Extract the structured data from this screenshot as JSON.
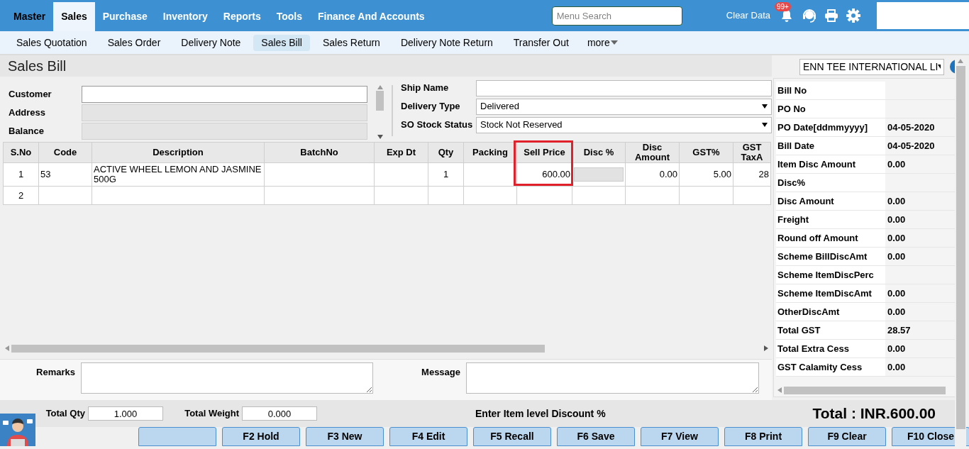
{
  "menu": [
    {
      "label": "Master",
      "selected": false
    },
    {
      "label": "Sales",
      "selected": true
    },
    {
      "label": "Purchase",
      "selected": false
    },
    {
      "label": "Inventory",
      "selected": false
    },
    {
      "label": "Reports",
      "selected": false
    },
    {
      "label": "Tools",
      "selected": false
    },
    {
      "label": "Finance And Accounts",
      "selected": false
    }
  ],
  "menu_search": {
    "placeholder": "Menu Search"
  },
  "clear_data": "Clear Data",
  "notification_badge": "99+",
  "submenu": [
    {
      "label": "Sales Quotation",
      "selected": false
    },
    {
      "label": "Sales Order",
      "selected": false
    },
    {
      "label": "Delivery Note",
      "selected": false
    },
    {
      "label": "Sales Bill",
      "selected": true
    },
    {
      "label": "Sales Return",
      "selected": false
    },
    {
      "label": "Delivery Note Return",
      "selected": false
    },
    {
      "label": "Transfer Out",
      "selected": false
    }
  ],
  "more": "more",
  "page_title": "Sales Bill",
  "company": "ENN TEE INTERNATIONAL LI",
  "left_fields": [
    {
      "label": "Customer",
      "disabled": false
    },
    {
      "label": "Address",
      "disabled": true
    },
    {
      "label": "Balance",
      "disabled": true
    }
  ],
  "right_fields": [
    {
      "label": "Ship Name",
      "kind": "text"
    },
    {
      "label": "Delivery Type",
      "kind": "select",
      "value": "Delivered"
    },
    {
      "label": "SO Stock Status",
      "kind": "select",
      "value": "Stock Not Reserved"
    }
  ],
  "table": {
    "columns": [
      {
        "label": "S.No",
        "highlight": false
      },
      {
        "label": "Code",
        "highlight": false
      },
      {
        "label": "Description",
        "highlight": false
      },
      {
        "label": "BatchNo",
        "highlight": false
      },
      {
        "label": "Exp Dt",
        "highlight": false
      },
      {
        "label": "Qty",
        "highlight": false
      },
      {
        "label": "Packing",
        "highlight": false
      },
      {
        "label": "Sell Price",
        "highlight": true
      },
      {
        "label": "Disc %",
        "highlight": false
      },
      {
        "label": "Disc Amount",
        "highlight": false
      },
      {
        "label": "GST%",
        "highlight": false
      },
      {
        "label": "GST TaxA",
        "highlight": false
      }
    ],
    "rows": [
      [
        "1",
        "53",
        "ACTIVE WHEEL LEMON AND JASMINE 500G",
        "",
        "",
        "1",
        "",
        "600.00",
        "",
        "0.00",
        "5.00",
        "28"
      ],
      [
        "2",
        "",
        "",
        "",
        "",
        "",
        "",
        "",
        "",
        "",
        "",
        ""
      ]
    ]
  },
  "summary": [
    {
      "label": "Bill No"
    },
    {
      "label": "PO No"
    },
    {
      "label": "PO Date[ddmmyyyy]",
      "value": "04-05-2020"
    },
    {
      "label": "Bill Date",
      "value": "04-05-2020"
    },
    {
      "label": "Item Disc Amount",
      "value": "0.00"
    },
    {
      "label": "Disc%"
    },
    {
      "label": "Disc Amount",
      "value": "0.00"
    },
    {
      "label": "Freight",
      "value": "0.00"
    },
    {
      "label": "Round off Amount",
      "value": "0.00"
    },
    {
      "label": "Scheme BillDiscAmt",
      "value": "0.00"
    },
    {
      "label": "Scheme ItemDiscPerc"
    },
    {
      "label": "Scheme ItemDiscAmt",
      "value": "0.00"
    },
    {
      "label": "OtherDiscAmt",
      "value": "0.00"
    },
    {
      "label": "Total GST",
      "value": "28.57"
    },
    {
      "label": "Total Extra Cess",
      "value": "0.00"
    },
    {
      "label": "GST Calamity Cess",
      "value": "0.00"
    }
  ],
  "remarks_label": "Remarks",
  "message_label": "Message",
  "total_qty": {
    "label": "Total Qty",
    "value": "1.000"
  },
  "total_weight": {
    "label": "Total Weight",
    "value": "0.000"
  },
  "hint": "Enter Item level Discount %",
  "total": "Total : INR.600.00",
  "buttons": [
    {
      "kind": "blank"
    },
    {
      "kind": "text",
      "label": "F2 Hold"
    },
    {
      "kind": "text",
      "label": "F3 New"
    },
    {
      "kind": "text",
      "label": "F4 Edit"
    },
    {
      "kind": "text",
      "label": "F5 Recall"
    },
    {
      "kind": "text",
      "label": "F6 Save"
    },
    {
      "kind": "text",
      "label": "F7 View"
    },
    {
      "kind": "text",
      "label": "F8 Print"
    },
    {
      "kind": "text",
      "label": "F9 Clear"
    },
    {
      "kind": "text",
      "label": "F10 Close"
    }
  ]
}
